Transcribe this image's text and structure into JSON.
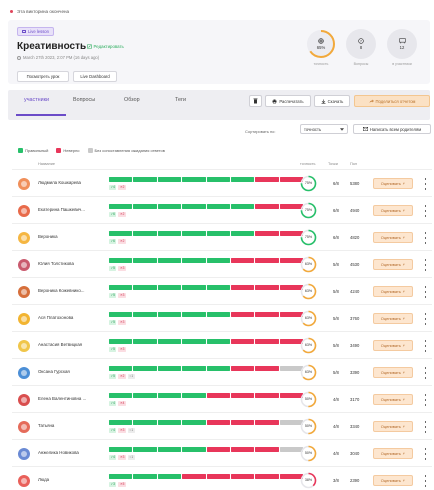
{
  "notice": "Эта викторина окончена",
  "header": {
    "badge": "Live lesson",
    "title": "Креативность",
    "edit_label": "Редактировать",
    "date": "March 27th 2023, 2:07 PM (16 days ago)",
    "view_lesson": "Посмотреть урок",
    "live_dashboard": "Live Dashboard",
    "stats": [
      {
        "icon": "target-icon",
        "value": "65%",
        "label": "точность",
        "fraction": 0.65
      },
      {
        "icon": "question-icon",
        "value": "8",
        "label": "Вопросы"
      },
      {
        "icon": "classroom-icon",
        "value": "12",
        "label": "в участники"
      }
    ]
  },
  "tabs": {
    "items": [
      "участники",
      "Вопросы",
      "Обзор",
      "Теги"
    ],
    "active": 0
  },
  "toolbar": {
    "print": "Распечатать",
    "download": "Скачать",
    "share": "Поделиться отчетом"
  },
  "sort": {
    "label": "Сортировать по:",
    "value": "точность",
    "message_btn": "Написать всем родителям"
  },
  "legend": {
    "correct": "Правильный",
    "wrong": "Неверно",
    "unanswered": "Без сопоставления ожидания ответов"
  },
  "columns": {
    "name": "Название",
    "accuracy": "точность",
    "score": "Точки",
    "points": "Пол"
  },
  "grade_label": "Оценивать",
  "colors": {
    "correct": "#27c06a",
    "wrong": "#e8365a",
    "unanswered": "#c9c9c9",
    "accent": "#6b4cc8"
  },
  "students": [
    {
      "name": "Людмила Кошкарева",
      "answers": "ggggggrr",
      "correct": "4",
      "wrong": "2",
      "none": "",
      "accuracy": "75%",
      "acc": 0.75,
      "score": "6/8",
      "points": "5380",
      "avatar": "#f08f5a"
    },
    {
      "name": "Екатерина Пашкевич...",
      "answers": "ggggggrr",
      "correct": "6",
      "wrong": "2",
      "none": "",
      "accuracy": "75%",
      "acc": 0.75,
      "score": "6/8",
      "points": "4940",
      "avatar": "#e86a4a"
    },
    {
      "name": "Вероника",
      "answers": "ggggggrr",
      "correct": "6",
      "wrong": "2",
      "none": "",
      "accuracy": "75%",
      "acc": 0.75,
      "score": "6/8",
      "points": "4820",
      "avatar": "#f5b642"
    },
    {
      "name": "Юлия Толстикова",
      "answers": "gggggrrr",
      "correct": "5",
      "wrong": "3",
      "none": "",
      "accuracy": "63%",
      "acc": 0.63,
      "score": "5/8",
      "points": "4530",
      "avatar": "#c95a6e"
    },
    {
      "name": "Вероника Кожевнико...",
      "answers": "gggggrrr",
      "correct": "5",
      "wrong": "3",
      "none": "",
      "accuracy": "63%",
      "acc": 0.63,
      "score": "5/8",
      "points": "4240",
      "avatar": "#d66f3b"
    },
    {
      "name": "Ася Платохонова",
      "answers": "gggggrrr",
      "correct": "5",
      "wrong": "3",
      "none": "",
      "accuracy": "63%",
      "acc": 0.63,
      "score": "5/8",
      "points": "3760",
      "avatar": "#f2b431"
    },
    {
      "name": "Анастасия Ветвицкая",
      "answers": "gggggrrr",
      "correct": "5",
      "wrong": "3",
      "none": "",
      "accuracy": "63%",
      "acc": 0.63,
      "score": "5/8",
      "points": "3490",
      "avatar": "#f0c64a"
    },
    {
      "name": "Оксана Гурская",
      "answers": "gggggrrn",
      "correct": "5",
      "wrong": "2",
      "none": "1",
      "accuracy": "63%",
      "acc": 0.63,
      "score": "5/8",
      "points": "3390",
      "avatar": "#4c8fd6"
    },
    {
      "name": "Елена Валентиновна ...",
      "answers": "ggggrrrr",
      "correct": "4",
      "wrong": "4",
      "none": "",
      "accuracy": "50%",
      "acc": 0.5,
      "score": "4/8",
      "points": "3170",
      "avatar": "#d94e4e"
    },
    {
      "name": "Татьяна",
      "answers": "ggggrrrn",
      "correct": "4",
      "wrong": "3",
      "none": "1",
      "accuracy": "50%",
      "acc": 0.5,
      "score": "4/8",
      "points": "3340",
      "avatar": "#e56b5a"
    },
    {
      "name": "Анжелика Новикова",
      "answers": "ggggrrrn",
      "correct": "4",
      "wrong": "3",
      "none": "1",
      "accuracy": "50%",
      "acc": 0.5,
      "score": "4/8",
      "points": "3040",
      "avatar": "#6a8ad4"
    },
    {
      "name": "Люда",
      "answers": "gggrrrrr",
      "correct": "3",
      "wrong": "5",
      "none": "",
      "accuracy": "38%",
      "acc": 0.38,
      "score": "3/8",
      "points": "2390",
      "avatar": "#e9605a"
    }
  ]
}
